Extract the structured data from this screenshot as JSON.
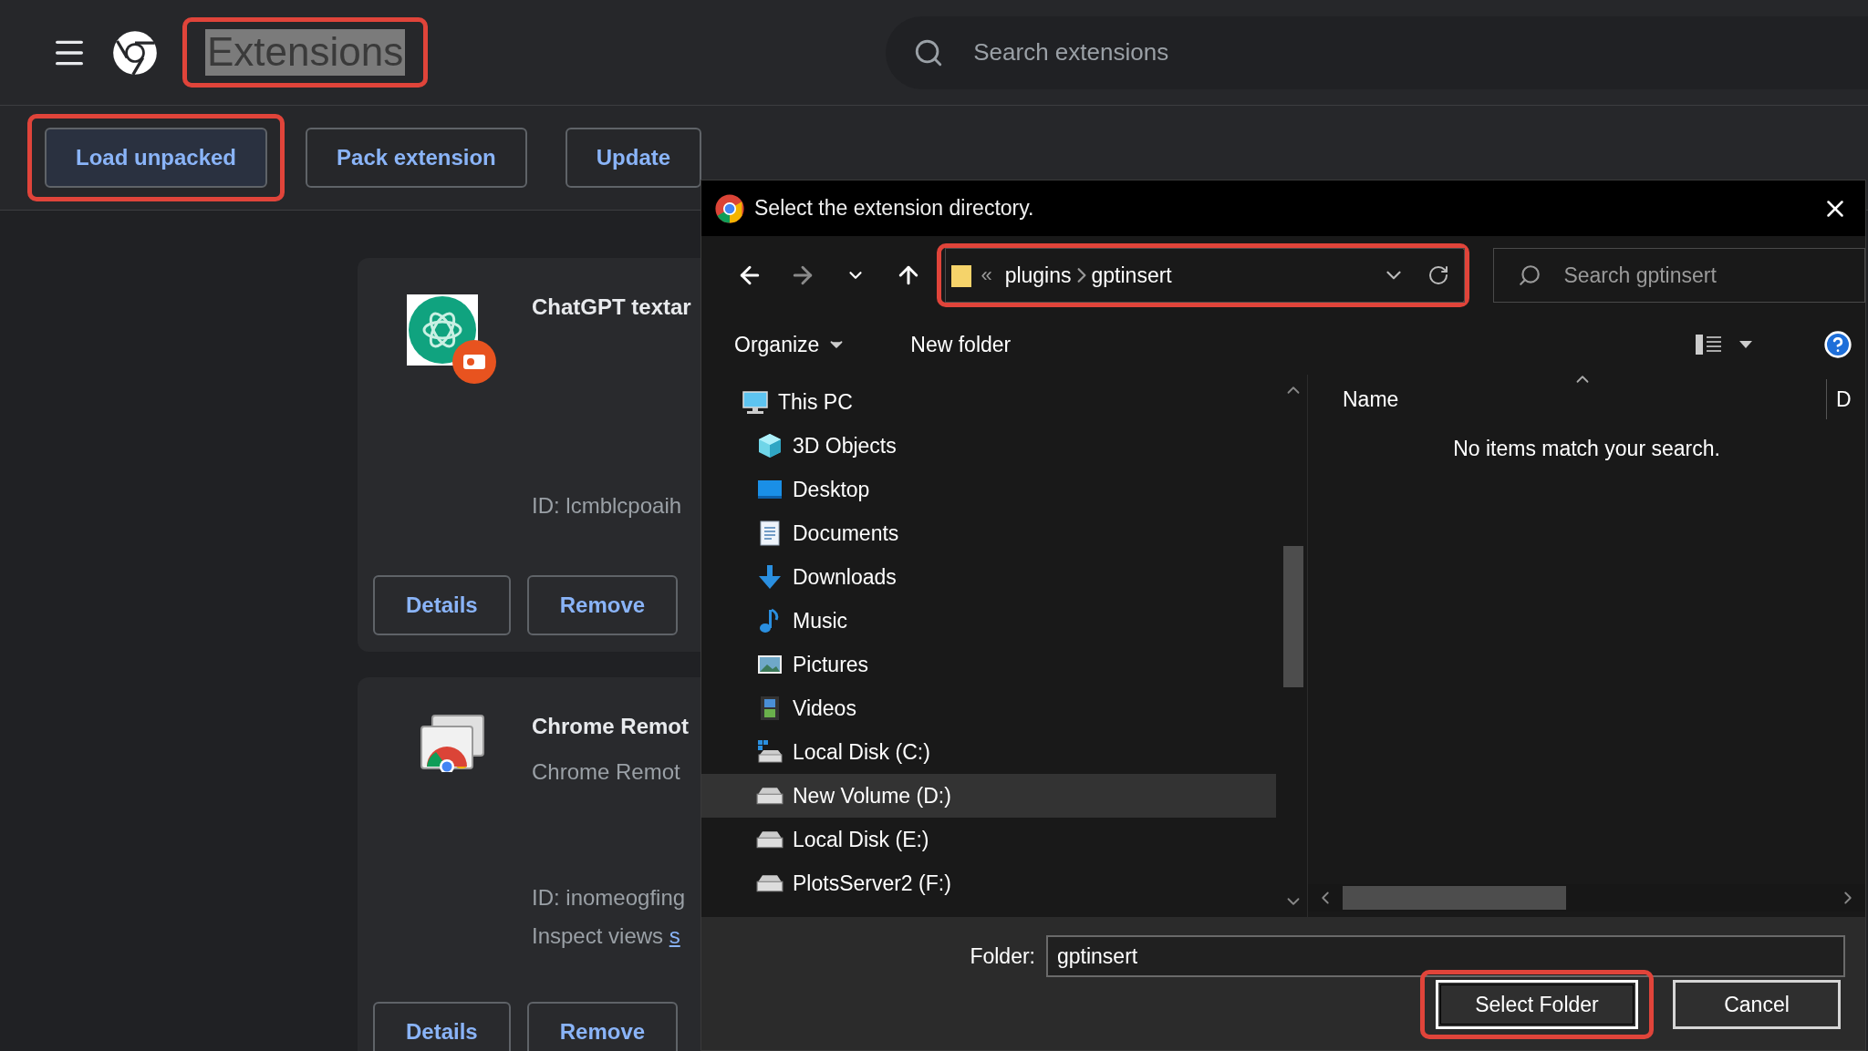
{
  "header": {
    "title": {
      "text": "Extensions",
      "text_selected": true,
      "highlighted": true
    },
    "search": {
      "placeholder": "Search extensions"
    }
  },
  "toolbar": {
    "buttons": [
      {
        "label": "Load unpacked",
        "focused": true,
        "highlighted": true
      },
      {
        "label": "Pack extension",
        "focused": false,
        "highlighted": false
      },
      {
        "label": "Update",
        "focused": false,
        "highlighted": false
      }
    ]
  },
  "extensions": [
    {
      "name": "ChatGPT textar",
      "id": "ID: lcmblcpoaih",
      "buttons": [
        "Details",
        "Remove"
      ]
    },
    {
      "name": "Chrome Remot",
      "description": "Chrome Remot",
      "id": "ID: inomeogfing",
      "inspect": {
        "text": "Inspect views",
        "link": "s"
      },
      "buttons": [
        "Details",
        "Remove"
      ]
    }
  ],
  "dialog": {
    "title": "Select the extension directory.",
    "nav": [
      {
        "kind": "back",
        "disabled": false
      },
      {
        "kind": "forward",
        "disabled": true
      },
      {
        "kind": "recent",
        "disabled": false
      },
      {
        "kind": "up",
        "disabled": false
      }
    ],
    "breadcrumb": {
      "overflow_mark": "«",
      "parts": [
        "plugins",
        "gptinsert"
      ],
      "highlighted": true
    },
    "search": {
      "placeholder": "Search gptinsert"
    },
    "commands": [
      {
        "label": "Organize",
        "menu": true
      },
      {
        "label": "New folder",
        "menu": false
      }
    ],
    "tree": [
      {
        "label": "This PC",
        "kind": "computer",
        "selected": false,
        "children": [
          {
            "label": "3D Objects",
            "kind": "objects",
            "selected": false
          },
          {
            "label": "Desktop",
            "kind": "desktop",
            "selected": false
          },
          {
            "label": "Documents",
            "kind": "documents",
            "selected": false
          },
          {
            "label": "Downloads",
            "kind": "downloads",
            "selected": false
          },
          {
            "label": "Music",
            "kind": "music",
            "selected": false
          },
          {
            "label": "Pictures",
            "kind": "pictures",
            "selected": false
          },
          {
            "label": "Videos",
            "kind": "videos",
            "selected": false
          },
          {
            "label": "Local Disk (C:)",
            "kind": "systemdrive",
            "selected": false
          },
          {
            "label": "New Volume (D:)",
            "kind": "drive",
            "selected": true
          },
          {
            "label": "Local Disk (E:)",
            "kind": "drive",
            "selected": false
          },
          {
            "label": "PlotsServer2 (F:)",
            "kind": "drive",
            "selected": false
          }
        ]
      }
    ],
    "columns": [
      "Name",
      "D"
    ],
    "empty_message": "No items match your search.",
    "folder_label": "Folder:",
    "folder_value": "gptinsert",
    "buttons": [
      {
        "label": "Select Folder",
        "default": true,
        "highlighted": true
      },
      {
        "label": "Cancel",
        "default": false,
        "highlighted": false
      }
    ]
  }
}
